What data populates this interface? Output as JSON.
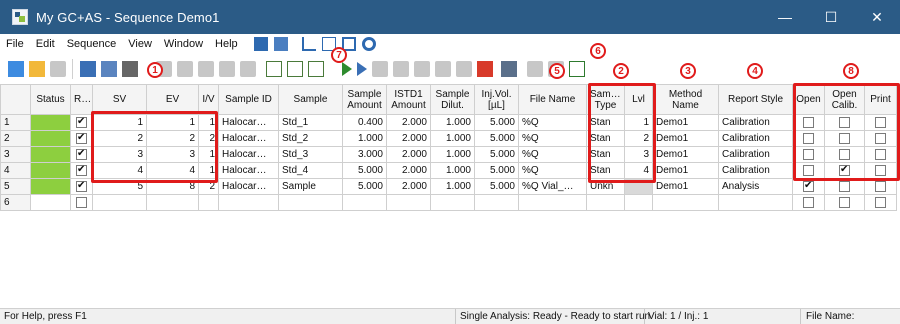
{
  "window": {
    "title": "My GC+AS - Sequence Demo1",
    "controls": [
      "—",
      "☐",
      "✕"
    ]
  },
  "menu": [
    "File",
    "Edit",
    "Sequence",
    "View",
    "Window",
    "Help"
  ],
  "columns": [
    "",
    "Status",
    "Run",
    "SV",
    "EV",
    "I/V",
    "Sample ID",
    "Sample",
    "Sample Amount",
    "ISTD1 Amount",
    "Sample Dilut.",
    "Inj.Vol. [µL]",
    "File Name",
    "Sample Type",
    "Lvl",
    "Method Name",
    "Report Style",
    "Open",
    "Open Calib.",
    "Print"
  ],
  "rows": [
    {
      "n": "1",
      "run": true,
      "sv": "1",
      "ev": "1",
      "iv": "1",
      "sample_id": "Halocar…",
      "sample": "Std_1",
      "amount": "0.400",
      "istd": "2.000",
      "dilut": "1.000",
      "injvol": "5.000",
      "file": "%Q",
      "type": "Stan",
      "lvl": "1",
      "method": "Demo1",
      "report": "Calibration",
      "open": false,
      "open_calib": false,
      "print": false
    },
    {
      "n": "2",
      "run": true,
      "sv": "2",
      "ev": "2",
      "iv": "2",
      "sample_id": "Halocar…",
      "sample": "Std_2",
      "amount": "1.000",
      "istd": "2.000",
      "dilut": "1.000",
      "injvol": "5.000",
      "file": "%Q",
      "type": "Stan",
      "lvl": "2",
      "method": "Demo1",
      "report": "Calibration",
      "open": false,
      "open_calib": false,
      "print": false
    },
    {
      "n": "3",
      "run": true,
      "sv": "3",
      "ev": "3",
      "iv": "1",
      "sample_id": "Halocar…",
      "sample": "Std_3",
      "amount": "3.000",
      "istd": "2.000",
      "dilut": "1.000",
      "injvol": "5.000",
      "file": "%Q",
      "type": "Stan",
      "lvl": "3",
      "method": "Demo1",
      "report": "Calibration",
      "open": false,
      "open_calib": false,
      "print": false
    },
    {
      "n": "4",
      "run": true,
      "sv": "4",
      "ev": "4",
      "iv": "1",
      "sample_id": "Halocar…",
      "sample": "Std_4",
      "amount": "5.000",
      "istd": "2.000",
      "dilut": "1.000",
      "injvol": "5.000",
      "file": "%Q",
      "type": "Stan",
      "lvl": "4",
      "method": "Demo1",
      "report": "Calibration",
      "open": false,
      "open_calib": true,
      "print": false
    },
    {
      "n": "5",
      "run": true,
      "sv": "5",
      "ev": "8",
      "iv": "2",
      "sample_id": "Halocar…",
      "sample": "Sample",
      "amount": "5.000",
      "istd": "2.000",
      "dilut": "1.000",
      "injvol": "5.000",
      "file": "%Q Vial_…",
      "type": "Unkn",
      "lvl": "",
      "method": "Demo1",
      "report": "Analysis",
      "open": true,
      "open_calib": false,
      "print": false
    }
  ],
  "empty_row": "6",
  "status": {
    "help": "For Help, press F1",
    "analysis": "Single Analysis: Ready - Ready to start run",
    "vial": "Vial: 1 / Inj.: 1",
    "file": "File Name:"
  },
  "annotations": [
    "1",
    "2",
    "3",
    "4",
    "5",
    "6",
    "7",
    "8"
  ]
}
